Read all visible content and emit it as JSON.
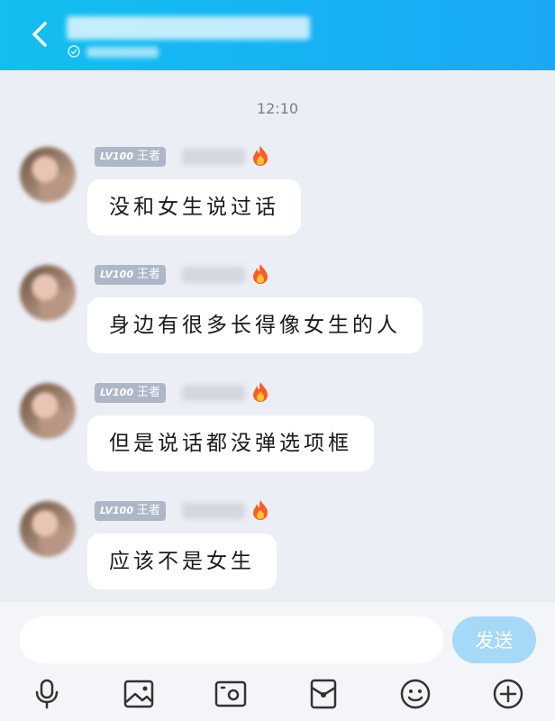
{
  "header": {
    "back_icon": "chevron-left-icon"
  },
  "chat": {
    "timestamp": "12:10",
    "messages": [
      {
        "level": "LV100",
        "title": "王者",
        "text": "没和女生说过话"
      },
      {
        "level": "LV100",
        "title": "王者",
        "text": "身边有很多长得像女生的人"
      },
      {
        "level": "LV100",
        "title": "王者",
        "text": "但是说话都没弹选项框"
      },
      {
        "level": "LV100",
        "title": "王者",
        "text": "应该不是女生"
      }
    ]
  },
  "composer": {
    "placeholder": "",
    "send_label": "发送"
  },
  "toolbar": {
    "icons": [
      "microphone-icon",
      "image-icon",
      "camera-icon",
      "red-packet-icon",
      "emoji-icon",
      "plus-icon"
    ]
  },
  "colors": {
    "header_start": "#12BFF0",
    "header_end": "#1AA8F5",
    "background": "#ECEEF5",
    "send_button": "#A6D8F7",
    "badge": "#AEB7C8"
  }
}
